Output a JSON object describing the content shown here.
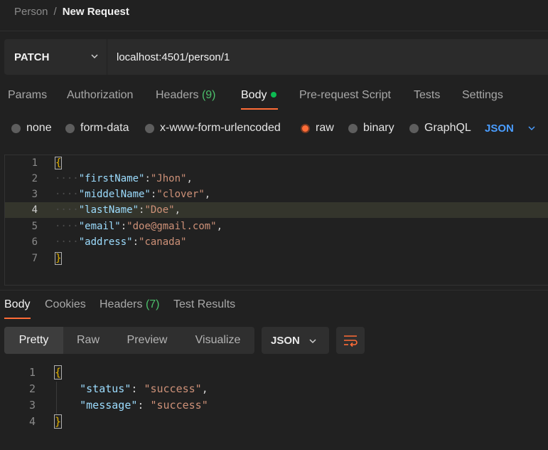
{
  "breadcrumb": {
    "parent": "Person",
    "separator": "/",
    "current": "New Request"
  },
  "request": {
    "method": "PATCH",
    "url": "localhost:4501/person/1"
  },
  "request_tabs": {
    "params": "Params",
    "authorization": "Authorization",
    "headers": "Headers",
    "headers_count": "(9)",
    "body": "Body",
    "prerequest": "Pre-request Script",
    "tests": "Tests",
    "settings": "Settings"
  },
  "body_types": {
    "none": "none",
    "form_data": "form-data",
    "urlencoded": "x-www-form-urlencoded",
    "raw": "raw",
    "binary": "binary",
    "graphql": "GraphQL",
    "selected": "raw",
    "language": "JSON"
  },
  "request_body": {
    "line_numbers": [
      "1",
      "2",
      "3",
      "4",
      "5",
      "6",
      "7"
    ],
    "open_brace": "{",
    "close_brace": "}",
    "fields": [
      {
        "key": "\"firstName\"",
        "value": "\"Jhon\"",
        "comma": ","
      },
      {
        "key": "\"middelName\"",
        "value": "\"clover\"",
        "comma": ","
      },
      {
        "key": "\"lastName\"",
        "value": "\"Doe\"",
        "comma": ","
      },
      {
        "key": "\"email\"",
        "value": "\"doe@gmail.com\"",
        "comma": ","
      },
      {
        "key": "\"address\"",
        "value": "\"canada\"",
        "comma": ""
      }
    ]
  },
  "response_tabs": {
    "body": "Body",
    "cookies": "Cookies",
    "headers": "Headers",
    "headers_count": "(7)",
    "test_results": "Test Results"
  },
  "response_view": {
    "pretty": "Pretty",
    "raw": "Raw",
    "preview": "Preview",
    "visualize": "Visualize",
    "format": "JSON"
  },
  "response_body": {
    "line_numbers": [
      "1",
      "2",
      "3",
      "4"
    ],
    "open_brace": "{",
    "close_brace": "}",
    "fields": [
      {
        "key": "\"status\"",
        "value": "\"success\"",
        "comma": ","
      },
      {
        "key": "\"message\"",
        "value": "\"success\"",
        "comma": ""
      }
    ]
  },
  "colors": {
    "accent": "#ff6c37",
    "link": "#4a9dff",
    "count": "#4cbf6b",
    "dot": "#0cbb52"
  },
  "icons": [
    "chevron-down-icon",
    "wrap-lines-icon"
  ]
}
